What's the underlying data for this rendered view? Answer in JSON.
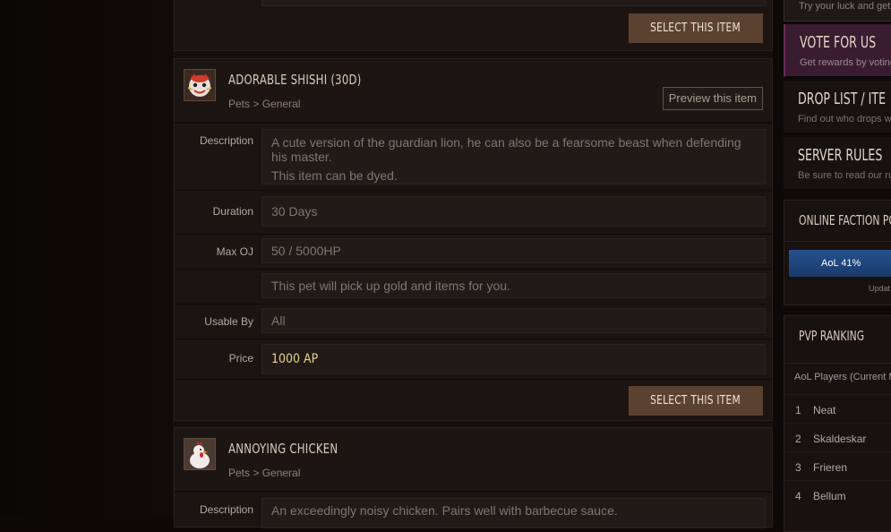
{
  "top_card": {
    "select_label": "SELECT THIS ITEM"
  },
  "items": [
    {
      "title": "ADORABLE SHISHI (30D)",
      "category": "Pets > General",
      "preview_label": "Preview this item",
      "rows": {
        "description_label": "Description",
        "description_text": "A cute version of the guardian lion, he can also be a fearsome beast when defending his master.",
        "description_note": "This item can be dyed.",
        "duration_label": "Duration",
        "duration_value": "30 Days",
        "maxoj_label": "Max OJ",
        "maxoj_value": "50 / 5000HP",
        "extra_value": "This pet will pick up gold and items for you.",
        "usable_label": "Usable By",
        "usable_value": "All",
        "price_label": "Price",
        "price_value": "1000 AP"
      },
      "select_label": "SELECT THIS ITEM"
    },
    {
      "title": "ANNOYING CHICKEN",
      "category": "Pets > General",
      "rows": {
        "description_label": "Description",
        "description_text": "An exceedingly noisy chicken. Pairs well with barbecue sauce."
      }
    }
  ],
  "sidebar": {
    "lucky_sub": "Try your luck and get",
    "vote_title": "VOTE FOR US",
    "vote_sub": "Get rewards by voting",
    "drop_title": "DROP LIST / ITE",
    "drop_sub": "Find out who drops w",
    "rules_title": "SERVER RULES",
    "rules_sub": "Be sure to read our ru",
    "faction_title": "ONLINE FACTION PO",
    "faction_bar_label": "AoL 41%",
    "faction_percent": 41,
    "faction_updated": "Updat",
    "pvp_title": "PVP RANKING",
    "pvp_subtitle": "AoL Players (Current M",
    "ranking": [
      {
        "rank": "1",
        "name": "Neat"
      },
      {
        "rank": "2",
        "name": "Skaldeskar"
      },
      {
        "rank": "3",
        "name": "Frieren"
      },
      {
        "rank": "4",
        "name": "Bellum"
      }
    ]
  },
  "colors": {
    "accent_button": "#5b4130",
    "price": "#e3d487",
    "faction_bar": "#1e3f72"
  }
}
